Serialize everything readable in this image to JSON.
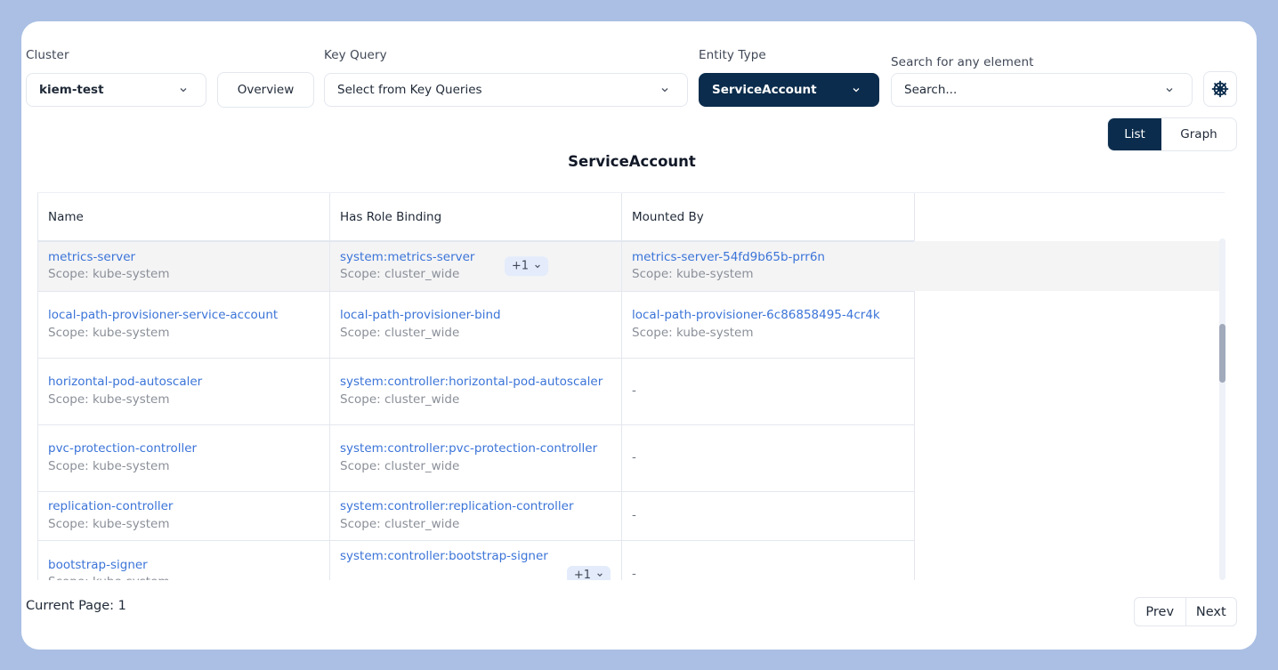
{
  "filters": {
    "cluster": {
      "label": "Cluster",
      "value": "kiem-test"
    },
    "overview_button": "Overview",
    "key_query": {
      "label": "Key Query",
      "value": "Select from Key Queries"
    },
    "entity_type": {
      "label": "Entity Type",
      "value": "ServiceAccount"
    },
    "search": {
      "label": "Search for any element",
      "placeholder": "Search..."
    },
    "helm_icon": "ship-wheel-icon"
  },
  "view_toggle": {
    "list": "List",
    "graph": "Graph",
    "active": "List"
  },
  "section_title": "ServiceAccount",
  "table": {
    "columns": [
      "Name",
      "Has Role Binding",
      "Mounted By"
    ],
    "rows": [
      {
        "name": "metrics-server",
        "name_scope": "Scope: kube-system",
        "binding": "system:metrics-server",
        "binding_scope": "Scope: cluster_wide",
        "binding_more": "+1",
        "mounted": "metrics-server-54fd9b65b-prr6n",
        "mounted_scope": "Scope: kube-system"
      },
      {
        "name": "local-path-provisioner-service-account",
        "name_scope": "Scope: kube-system",
        "binding": "local-path-provisioner-bind",
        "binding_scope": "Scope: cluster_wide",
        "mounted": "local-path-provisioner-6c86858495-4cr4k",
        "mounted_scope": "Scope: kube-system"
      },
      {
        "name": "horizontal-pod-autoscaler",
        "name_scope": "Scope: kube-system",
        "binding": "system:controller:horizontal-pod-autoscaler",
        "binding_scope": "Scope: cluster_wide",
        "mounted": "-"
      },
      {
        "name": "pvc-protection-controller",
        "name_scope": "Scope: kube-system",
        "binding": "system:controller:pvc-protection-controller",
        "binding_scope": "Scope: cluster_wide",
        "mounted": "-"
      },
      {
        "name": "replication-controller",
        "name_scope": "Scope: kube-system",
        "binding": "system:controller:replication-controller",
        "binding_scope": "Scope: cluster_wide",
        "mounted": "-"
      },
      {
        "name": "bootstrap-signer",
        "name_scope": "Scope: kube-system",
        "binding": "system:controller:bootstrap-signer",
        "binding_more": "+1",
        "mounted": "-"
      }
    ]
  },
  "pagination": {
    "current_page_text": "Current Page: 1",
    "prev": "Prev",
    "next": "Next"
  },
  "colors": {
    "primary": "#0b2c4c",
    "link": "#3b74d8",
    "frame": "#aabfe3"
  }
}
